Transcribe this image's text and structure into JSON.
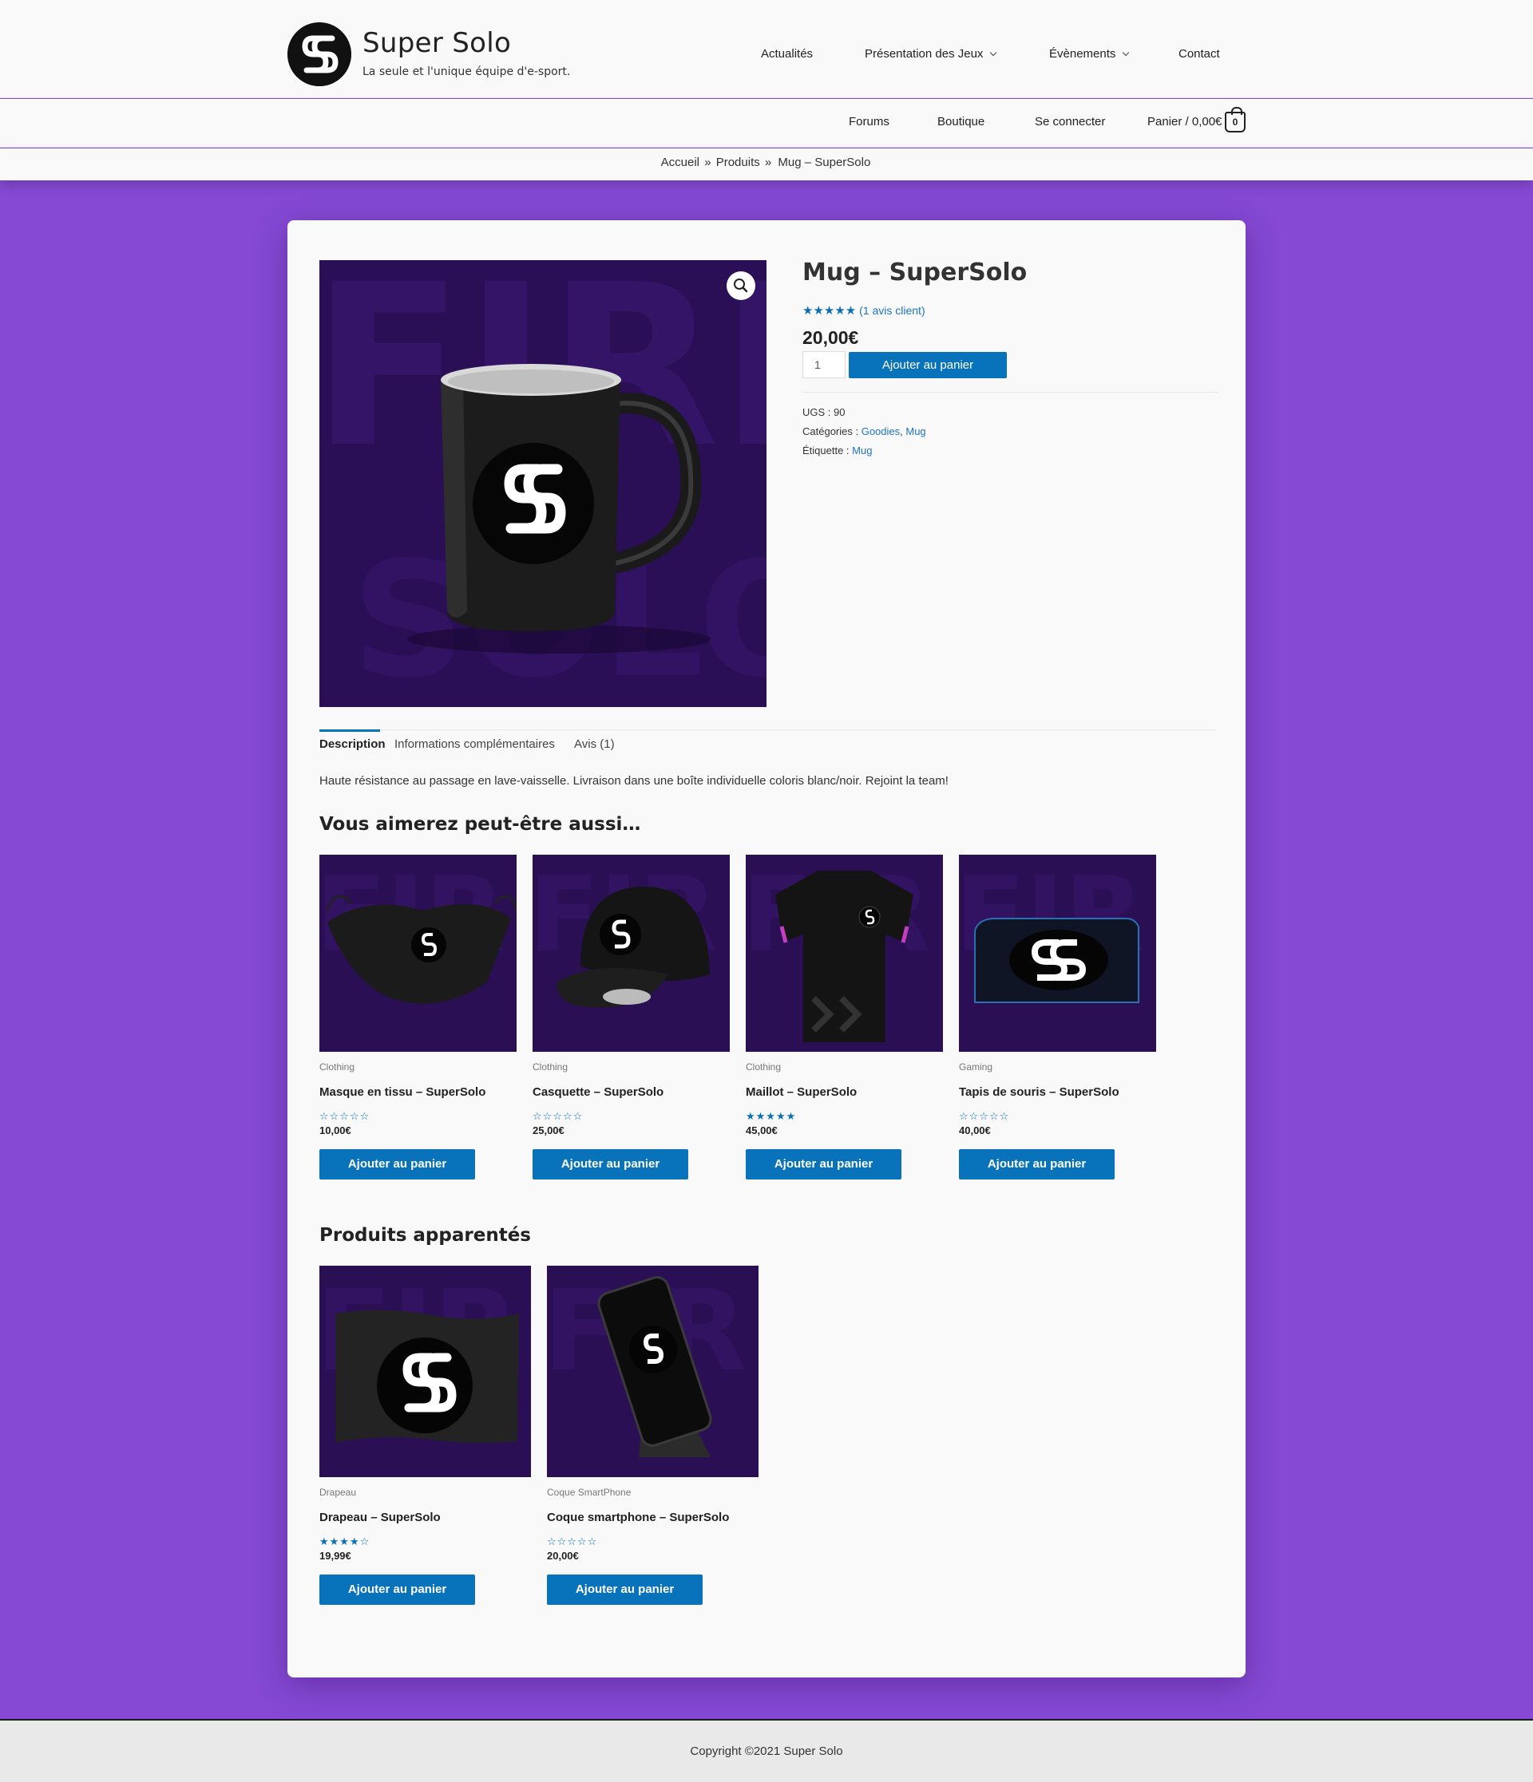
{
  "site": {
    "title": "Super Solo",
    "tagline": "La seule et l'unique équipe d'e-sport."
  },
  "nav": {
    "primary": [
      "Actualités",
      "Présentation des Jeux",
      "Évènements",
      "Contact"
    ],
    "secondary": [
      "Forums",
      "Boutique",
      "Se connecter"
    ],
    "cart_label": "Panier / 0,00€",
    "cart_count": "0"
  },
  "breadcrumb": [
    "Accueil",
    "Produits",
    "Mug – SuperSolo"
  ],
  "product": {
    "title": "Mug – SuperSolo",
    "rating_stars": "★★★★★",
    "reviews_link": "(1 avis client)",
    "price": "20,00€",
    "quantity": "1",
    "add_to_cart": "Ajouter au panier",
    "sku_label": "UGS : 90",
    "categories_label": "Catégories :",
    "categories": [
      "Goodies",
      "Mug"
    ],
    "tag_label": "Étiquette :",
    "tag": "Mug"
  },
  "tabs": [
    "Description",
    "Informations complémentaires",
    "Avis (1)"
  ],
  "description": "Haute résistance au passage en lave-vaisselle. Livraison dans une boîte individuelle coloris blanc/noir. Rejoint la team!",
  "upsells": {
    "title": "Vous aimerez peut-être aussi…",
    "items": [
      {
        "category": "Clothing",
        "name": "Masque en tissu – SuperSolo",
        "stars": "☆☆☆☆☆",
        "price": "10,00€",
        "button": "Ajouter au panier"
      },
      {
        "category": "Clothing",
        "name": "Casquette – SuperSolo",
        "stars": "☆☆☆☆☆",
        "price": "25,00€",
        "button": "Ajouter au panier"
      },
      {
        "category": "Clothing",
        "name": "Maillot – SuperSolo",
        "stars": "★★★★★",
        "price": "45,00€",
        "button": "Ajouter au panier"
      },
      {
        "category": "Gaming",
        "name": "Tapis de souris – SuperSolo",
        "stars": "☆☆☆☆☆",
        "price": "40,00€",
        "button": "Ajouter au panier"
      }
    ]
  },
  "related": {
    "title": "Produits apparentés",
    "items": [
      {
        "category": "Drapeau",
        "name": "Drapeau – SuperSolo",
        "stars": "★★★★☆",
        "price": "19,99€",
        "button": "Ajouter au panier"
      },
      {
        "category": "Coque SmartPhone",
        "name": "Coque smartphone – SuperSolo",
        "stars": "☆☆☆☆☆",
        "price": "20,00€",
        "button": "Ajouter au panier"
      }
    ]
  },
  "footer": "Copyright ©2021 Super Solo",
  "colors": {
    "accent": "#0872ba",
    "background": "#8549d3",
    "image_bg": "#2a0f55"
  }
}
